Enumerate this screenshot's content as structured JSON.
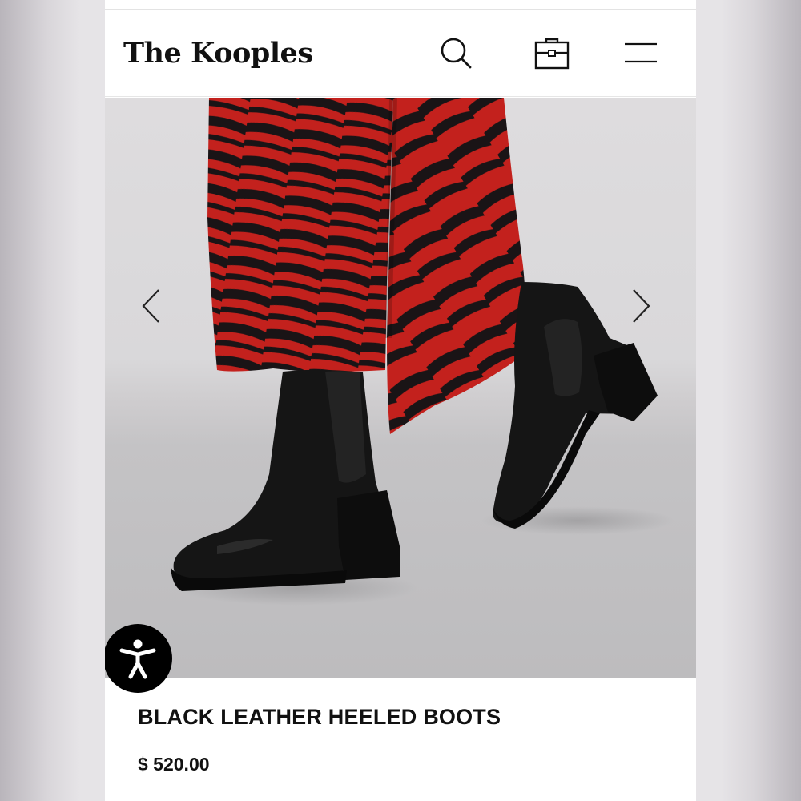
{
  "header": {
    "logo": "The Kooples",
    "icons": [
      "search-icon",
      "shopping-bag-icon",
      "menu-icon"
    ]
  },
  "gallery": {
    "prev_icon": "chevron-left-icon",
    "next_icon": "chevron-right-icon"
  },
  "accessibility": {
    "icon": "accessibility-icon"
  },
  "product": {
    "title": "BLACK LEATHER HEELED BOOTS",
    "price": "$ 520.00"
  },
  "colors": {
    "background": "#ffffff",
    "text": "#111111",
    "skirt_red": "#c3211d",
    "skirt_black": "#1a1416",
    "boot": "#141414"
  }
}
